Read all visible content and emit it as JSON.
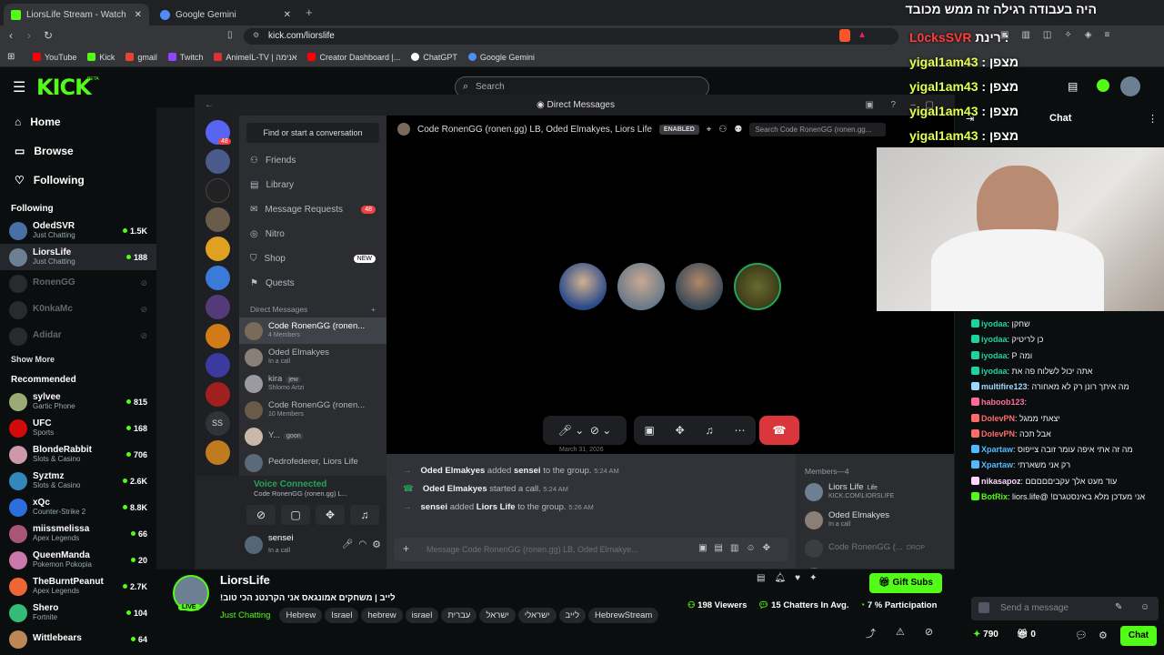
{
  "browser": {
    "tabs": [
      {
        "label": "LiorsLife Stream - Watch Live on",
        "active": true,
        "color": "#53fc18"
      },
      {
        "label": "Google Gemini",
        "active": false,
        "color": "#4f8df5"
      }
    ],
    "new_tab": "+",
    "url": "kick.com/liorslife",
    "bookmarks": [
      {
        "label": "YouTube",
        "color": "#ff0000"
      },
      {
        "label": "Kick",
        "color": "#53fc18"
      },
      {
        "label": "gmail",
        "color": "#ea4335"
      },
      {
        "label": "Twitch",
        "color": "#9146ff"
      },
      {
        "label": "AnimeIL-TV | אנימה",
        "color": "#d33"
      },
      {
        "label": "Creator Dashboard |...",
        "color": "#ff0000"
      },
      {
        "label": "ChatGPT",
        "color": "#ffffff"
      },
      {
        "label": "Google Gemini",
        "color": "#4f8df5"
      }
    ]
  },
  "kick": {
    "logo": "KICK",
    "logo_beta": "BETA",
    "search_placeholder": "Search",
    "nav": [
      {
        "label": "Home",
        "icon": "home-icon",
        "glyph": "⌂"
      },
      {
        "label": "Browse",
        "icon": "browse-icon",
        "glyph": "▭"
      },
      {
        "label": "Following",
        "icon": "heart-icon",
        "glyph": "♡"
      }
    ],
    "following_title": "Following",
    "following": [
      {
        "name": "OdedSVR",
        "sub": "Just Chatting",
        "viewers": "1.5K",
        "live": true,
        "color": "#4a6fa5"
      },
      {
        "name": "LiorsLife",
        "sub": "Just Chatting",
        "viewers": "188",
        "live": true,
        "color": "#6d7f92"
      },
      {
        "name": "RonenGG",
        "sub": "",
        "viewers": "",
        "live": false,
        "color": "#555"
      },
      {
        "name": "K0nkaMc",
        "sub": "",
        "viewers": "",
        "live": false,
        "color": "#555"
      },
      {
        "name": "Adidar",
        "sub": "",
        "viewers": "",
        "live": false,
        "color": "#555"
      }
    ],
    "show_more": "Show More",
    "recommended_title": "Recommended",
    "recommended": [
      {
        "name": "sylvee",
        "sub": "Gartic Phone",
        "viewers": "815",
        "color": "#9a7"
      },
      {
        "name": "UFC",
        "sub": "Sports",
        "viewers": "168",
        "color": "#d20a0a"
      },
      {
        "name": "BlondeRabbit",
        "sub": "Slots & Casino",
        "viewers": "706",
        "color": "#c9a"
      },
      {
        "name": "Syztmz",
        "sub": "Slots & Casino",
        "viewers": "2.6K",
        "color": "#38b"
      },
      {
        "name": "xQc",
        "sub": "Counter-Strike 2",
        "viewers": "8.8K",
        "color": "#2a6fdc"
      },
      {
        "name": "miissmelissa",
        "sub": "Apex Legends",
        "viewers": "66",
        "color": "#a57"
      },
      {
        "name": "QueenManda",
        "sub": "Pokemon Pokopia",
        "viewers": "20",
        "color": "#c7a"
      },
      {
        "name": "TheBurntPeanut",
        "sub": "Apex Legends",
        "viewers": "2.7K",
        "color": "#e63"
      },
      {
        "name": "Shero",
        "sub": "Fortnite",
        "viewers": "104",
        "color": "#3b7"
      },
      {
        "name": "Wittlebears",
        "sub": "",
        "viewers": "64",
        "color": "#b85"
      }
    ]
  },
  "discord": {
    "title": "Direct Messages",
    "find_placeholder": "Find or start a conversation",
    "nav": [
      {
        "label": "Friends",
        "icon": "friends-icon",
        "badge": ""
      },
      {
        "label": "Library",
        "icon": "library-icon",
        "badge": ""
      },
      {
        "label": "Message Requests",
        "icon": "mail-icon",
        "badge": "48"
      },
      {
        "label": "Nitro",
        "icon": "nitro-icon",
        "badge": ""
      },
      {
        "label": "Shop",
        "icon": "shop-icon",
        "badge": "NEW"
      },
      {
        "label": "Quests",
        "icon": "quests-icon",
        "badge": ""
      }
    ],
    "home_badge": "48",
    "dm_header": "Direct Messages",
    "dms": [
      {
        "name": "Code RonenGG (ronen...",
        "sub": "4 Members",
        "color": "#7a6a5a",
        "selected": true
      },
      {
        "name": "Oded Elmakyes",
        "sub": "In a call",
        "color": "#8a7f76",
        "selected": false
      },
      {
        "name": "kira",
        "tag": "jew",
        "sub": "Shlomo Artzi",
        "color": "#9a9aa0",
        "selected": false
      },
      {
        "name": "Code RonenGG (ronen...",
        "sub": "10 Members",
        "color": "#6a5a4a",
        "selected": false
      },
      {
        "name": "Y...",
        "tag": "goon",
        "sub": "",
        "color": "#c9b8a8",
        "selected": false
      },
      {
        "name": "Pedrofederer, Liors Life",
        "sub": "",
        "color": "#5a6a7a",
        "selected": false
      }
    ],
    "guild_ss": "SS",
    "voice": {
      "status": "Voice Connected",
      "channel": "Code RonenGG (ronen.gg) L..."
    },
    "user": {
      "name": "sensei",
      "status": "In a call"
    },
    "call": {
      "title": "Code RonenGG (ronen.gg) LB, Oded Elmakyes, Liors Life",
      "enabled": "ENABLED",
      "search_placeholder": "Search Code RonenGG (ronen.gg...",
      "date": "March 31, 2026"
    },
    "messages": [
      {
        "actor": "Oded Elmakyes",
        "action": "added",
        "target": "sensei",
        "rest": "to the group.",
        "time": "5:24 AM"
      },
      {
        "actor": "Oded Elmakyes",
        "action": "started a call.",
        "target": "",
        "rest": "",
        "time": "5:24 AM"
      },
      {
        "actor": "sensei",
        "action": "added",
        "target": "Liors Life",
        "rest": "to the group.",
        "time": "5:26 AM"
      }
    ],
    "message_placeholder": "Message Code RonenGG (ronen.gg) LB, Oded Elmakye...",
    "members_title": "Members—4",
    "members": [
      {
        "name": "Liors Life",
        "sub": "KICK.COM\\LIORSLIFE",
        "tag": "Life",
        "color": "#6d7f92"
      },
      {
        "name": "Oded Elmakyes",
        "sub": "In a call",
        "tag": "",
        "color": "#8a7f76"
      },
      {
        "name": "Code RonenGG (...",
        "sub": "",
        "tag": "DROP",
        "color": "#555"
      },
      {
        "name": "sensei",
        "sub": "",
        "tag": "",
        "color": "#567"
      }
    ]
  },
  "stream": {
    "name": "LiorsLife",
    "live": "LIVE",
    "title": "לייב | משחקים אמונגאס אני הקרנטנ הכי טוב!",
    "category": "Just Chatting",
    "tags": [
      "Hebrew",
      "Israel",
      "hebrew",
      "israel",
      "עברית",
      "ישראל",
      "ישראלי",
      "לייב",
      "HebrewStream"
    ],
    "viewers": "198 Viewers",
    "chatters": "15 Chatters In Avg.",
    "participation": "7 % Participation",
    "gift": "Gift Subs"
  },
  "overlay": {
    "top_message": "היה בעבודה רגילה זה ממש מכובד",
    "lines": [
      {
        "name": "L0cksSVR",
        "text": "רינת :"
      },
      {
        "name": "yigal1am43",
        "text": ": מצפן"
      },
      {
        "name": "yigal1am43",
        "text": ": מצפן"
      },
      {
        "name": "yigal1am43",
        "text": ": מצפן"
      },
      {
        "name": "yigal1am43",
        "text": ": מצפן"
      }
    ]
  },
  "chat": {
    "title": "Chat",
    "messages": [
      {
        "user": "iyodaa",
        "text": "שחקן",
        "color": "#1bd3a0"
      },
      {
        "user": "iyodaa",
        "text": "כן לריטיק",
        "color": "#1bd3a0"
      },
      {
        "user": "iyodaa",
        "text": "ומה P",
        "color": "#1bd3a0"
      },
      {
        "user": "iyodaa",
        "text": "אתה יכול לשלוח פה את",
        "color": "#1bd3a0"
      },
      {
        "user": "multifire123",
        "text": "מה איתך רונן רק לא מאחורה",
        "color": "#9fd8ff"
      },
      {
        "user": "haboob123",
        "text": "",
        "color": "#ff6b9a"
      },
      {
        "user": "DolevPN",
        "text": "יצאתי ממגל",
        "color": "#ff6b6b"
      },
      {
        "user": "DolevPN",
        "text": "אבל תכה",
        "color": "#ff6b6b"
      },
      {
        "user": "Xpartaw",
        "text": "מה זה אתי איפה עומר זובה צייפוס",
        "color": "#53b9ff"
      },
      {
        "user": "Xpartaw",
        "text": "רק אני משארתי",
        "color": "#53b9ff"
      },
      {
        "user": "nikasapoz",
        "text": "עוד מעט אלך עקביםםםםם",
        "color": "#ffd6ff"
      },
      {
        "user": "BotRix",
        "text": "אני מעדכן מלא באינסטגרם! @liors.life",
        "color": "#53fc18"
      }
    ],
    "input_placeholder": "Send a message",
    "points": "790",
    "count": "0",
    "send": "Chat"
  }
}
